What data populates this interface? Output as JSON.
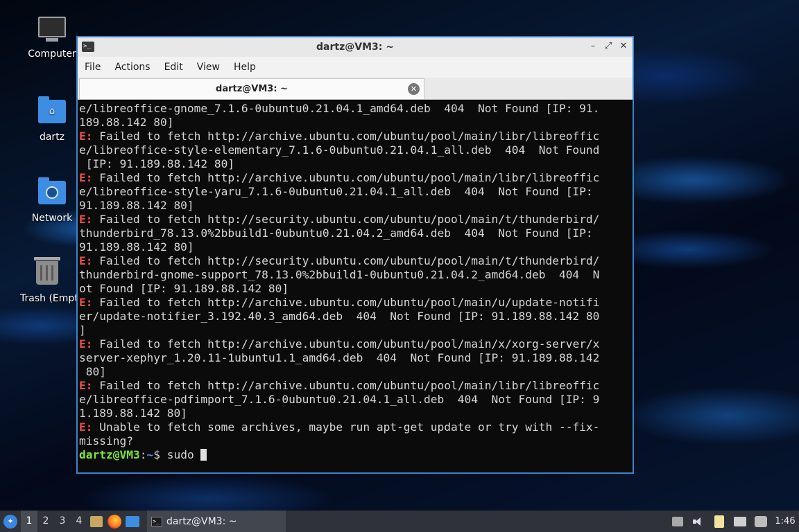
{
  "desktop": {
    "icons": [
      {
        "label": "Computer",
        "icon": "computer-icon"
      },
      {
        "label": "dartz",
        "icon": "home-folder-icon"
      },
      {
        "label": "Network",
        "icon": "network-folder-icon"
      },
      {
        "label": "Trash (Empty)",
        "icon": "trash-icon"
      }
    ]
  },
  "window": {
    "title": "dartz@VM3: ~",
    "controls": {
      "minimize": "–",
      "maximize": "⤢",
      "close": "✕"
    },
    "menu": [
      "File",
      "Actions",
      "Edit",
      "View",
      "Help"
    ],
    "tab": {
      "title": "dartz@VM3: ~",
      "close": "✕"
    }
  },
  "terminal": {
    "lines": [
      {
        "err": "",
        "text": "e/libreoffice-gnome_7.1.6-0ubuntu0.21.04.1_amd64.deb  404  Not Found [IP: 91."
      },
      {
        "err": "",
        "text": "189.88.142 80]"
      },
      {
        "err": "E:",
        "text": " Failed to fetch http://archive.ubuntu.com/ubuntu/pool/main/libr/libreoffic"
      },
      {
        "err": "",
        "text": "e/libreoffice-style-elementary_7.1.6-0ubuntu0.21.04.1_all.deb  404  Not Found"
      },
      {
        "err": "",
        "text": " [IP: 91.189.88.142 80]"
      },
      {
        "err": "E:",
        "text": " Failed to fetch http://archive.ubuntu.com/ubuntu/pool/main/libr/libreoffic"
      },
      {
        "err": "",
        "text": "e/libreoffice-style-yaru_7.1.6-0ubuntu0.21.04.1_all.deb  404  Not Found [IP:"
      },
      {
        "err": "",
        "text": "91.189.88.142 80]"
      },
      {
        "err": "E:",
        "text": " Failed to fetch http://security.ubuntu.com/ubuntu/pool/main/t/thunderbird/"
      },
      {
        "err": "",
        "text": "thunderbird_78.13.0%2bbuild1-0ubuntu0.21.04.2_amd64.deb  404  Not Found [IP:"
      },
      {
        "err": "",
        "text": "91.189.88.142 80]"
      },
      {
        "err": "E:",
        "text": " Failed to fetch http://security.ubuntu.com/ubuntu/pool/main/t/thunderbird/"
      },
      {
        "err": "",
        "text": "thunderbird-gnome-support_78.13.0%2bbuild1-0ubuntu0.21.04.2_amd64.deb  404  N"
      },
      {
        "err": "",
        "text": "ot Found [IP: 91.189.88.142 80]"
      },
      {
        "err": "E:",
        "text": " Failed to fetch http://archive.ubuntu.com/ubuntu/pool/main/u/update-notifi"
      },
      {
        "err": "",
        "text": "er/update-notifier_3.192.40.3_amd64.deb  404  Not Found [IP: 91.189.88.142 80"
      },
      {
        "err": "",
        "text": "]"
      },
      {
        "err": "E:",
        "text": " Failed to fetch http://archive.ubuntu.com/ubuntu/pool/main/x/xorg-server/x"
      },
      {
        "err": "",
        "text": "server-xephyr_1.20.11-1ubuntu1.1_amd64.deb  404  Not Found [IP: 91.189.88.142"
      },
      {
        "err": "",
        "text": " 80]"
      },
      {
        "err": "E:",
        "text": " Failed to fetch http://archive.ubuntu.com/ubuntu/pool/main/libr/libreoffic"
      },
      {
        "err": "",
        "text": "e/libreoffice-pdfimport_7.1.6-0ubuntu0.21.04.1_all.deb  404  Not Found [IP: 9"
      },
      {
        "err": "",
        "text": "1.189.88.142 80]"
      },
      {
        "err": "E:",
        "text": " Unable to fetch some archives, maybe run apt-get update or try with --fix-"
      },
      {
        "err": "",
        "text": "missing?"
      }
    ],
    "prompt": {
      "user": "dartz@VM3",
      "sep": ":",
      "path": "~",
      "symbol": "$",
      "command": " sudo "
    }
  },
  "taskbar": {
    "start_icon": "start-menu-icon",
    "workspaces": [
      "1",
      "2",
      "3",
      "4"
    ],
    "active_workspace": "1",
    "launchers": [
      "file-manager-icon",
      "firefox-icon",
      "show-desktop-icon"
    ],
    "task_title": "dartz@VM3: ~",
    "tray": [
      "window-icon",
      "volume-icon",
      "clipboard-icon",
      "network-icon",
      "notification-icon"
    ],
    "clock": "1:46"
  }
}
